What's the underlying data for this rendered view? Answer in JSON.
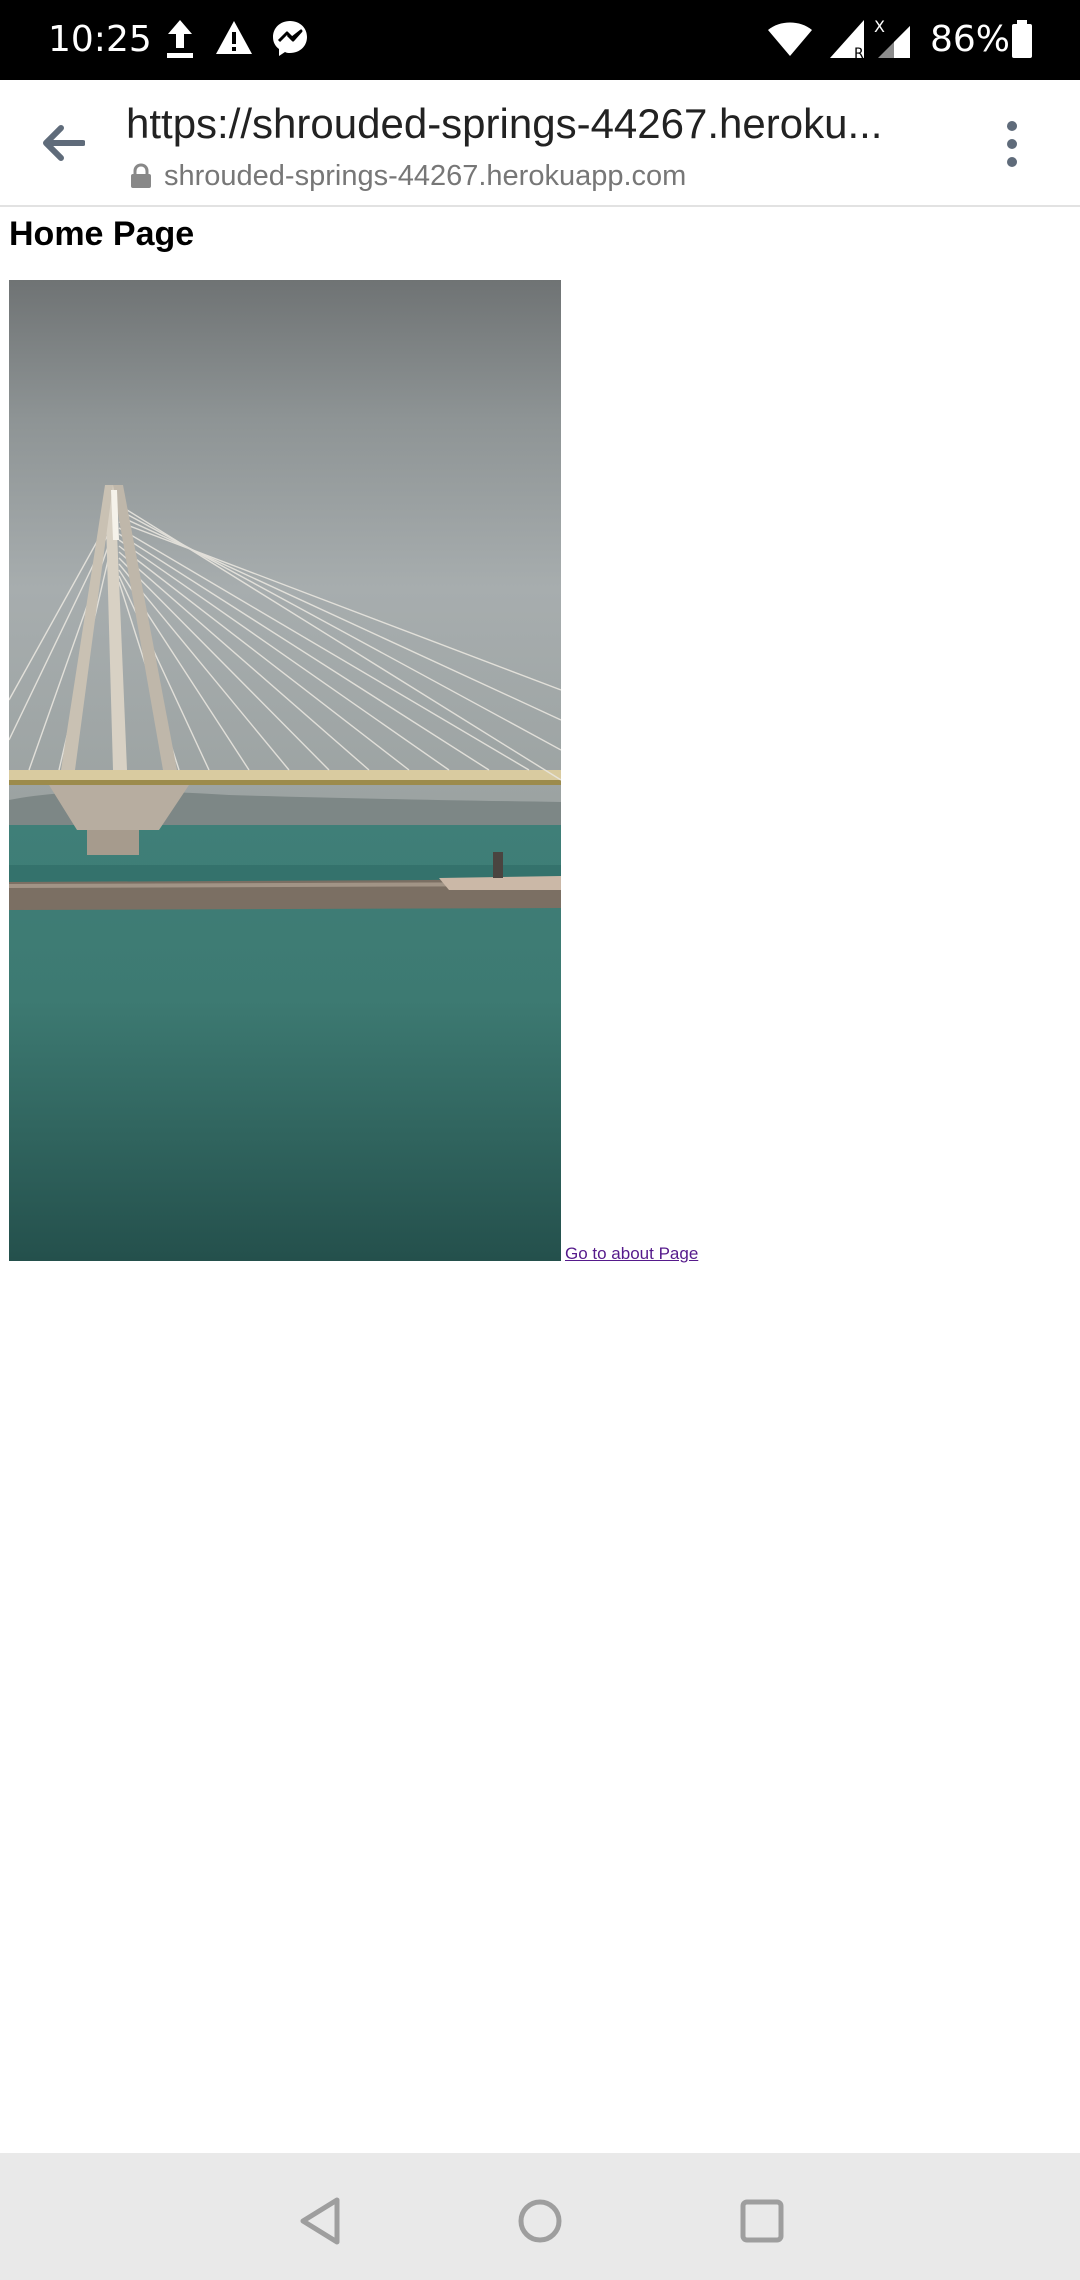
{
  "status_bar": {
    "time": "10:25",
    "battery_percent": "86%",
    "icons": [
      "upload-icon",
      "warning-icon",
      "messenger-icon",
      "wifi-icon",
      "signal-r-icon",
      "signal-x-icon",
      "battery-icon"
    ],
    "signal_r_label": "R",
    "signal_x_label": "X"
  },
  "browser": {
    "url_title": "https://shrouded-springs-44267.heroku...",
    "domain": "shrouded-springs-44267.herokuapp.com",
    "back_icon": "arrow-left-icon",
    "lock_icon": "lock-icon",
    "menu_icon": "more-vert-icon"
  },
  "page": {
    "title": "Home Page",
    "image_description": "cable-stayed bridge over sea",
    "link_text": "Go to about Page"
  },
  "nav_bar": {
    "icons": [
      "back-triangle-icon",
      "home-circle-icon",
      "recents-square-icon"
    ]
  },
  "colors": {
    "status_bar": "#000000",
    "link": "#551a8b",
    "nav_bar": "#e9e9e9",
    "toolbar_icon": "#5f6b7a"
  }
}
